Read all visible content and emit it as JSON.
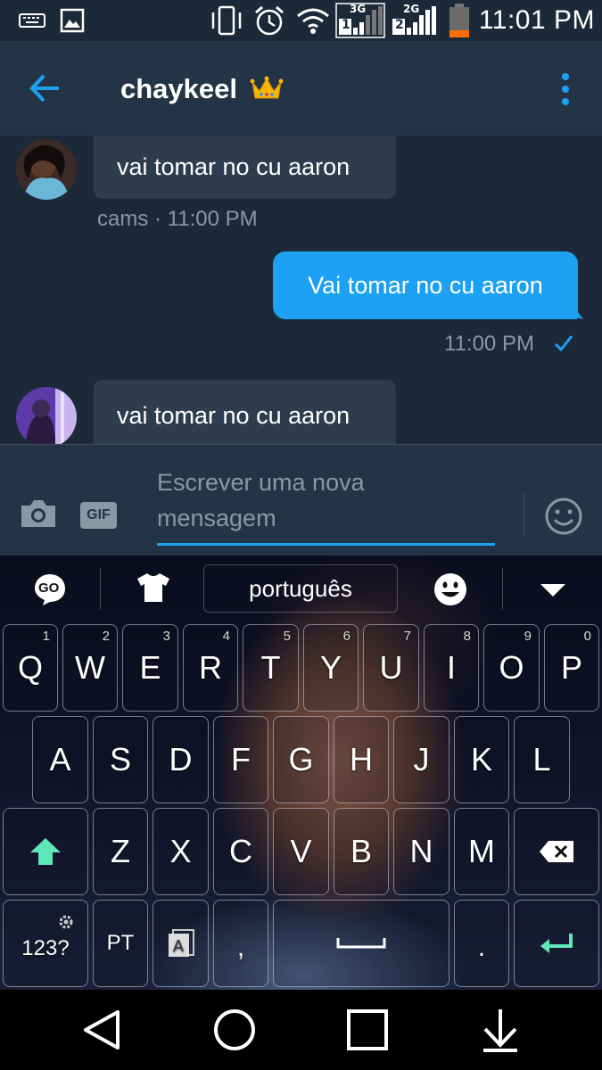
{
  "status_bar": {
    "time": "11:01 PM",
    "sim1_network": "3G",
    "sim1_slot": "1",
    "sim2_network": "2G",
    "sim2_slot": "2",
    "icons": [
      "keyboard-icon",
      "image-icon",
      "vibrate-icon",
      "alarm-icon",
      "wifi-icon",
      "signal-sim1-icon",
      "signal-sim2-icon",
      "battery-icon"
    ],
    "battery_color": "#ff6d00"
  },
  "header": {
    "title": "chaykeel",
    "icons": [
      "back-arrow-icon",
      "crown-emoji",
      "more-vert-icon"
    ]
  },
  "messages": [
    {
      "direction": "incoming",
      "text": "vai tomar no cu aaron",
      "meta": "cams · 11:00 PM"
    },
    {
      "direction": "outgoing",
      "text": "Vai tomar no cu aaron",
      "meta": "11:00 PM",
      "read_icon": "check-icon"
    },
    {
      "direction": "incoming",
      "text": "vai tomar no cu aaron"
    }
  ],
  "composer": {
    "placeholder_line1": "Escrever uma nova",
    "placeholder_line2": "mensagem",
    "icons": [
      "camera-icon",
      "gif-icon",
      "emoji-smiley-icon"
    ],
    "gif_label": "GIF"
  },
  "keyboard": {
    "toolbar": {
      "go_label": "GO",
      "language": "português",
      "icons": [
        "go-logo-icon",
        "theme-shirt-icon",
        "emoji-icon",
        "collapse-triangle-icon"
      ]
    },
    "row1": [
      {
        "k": "Q",
        "h": "1"
      },
      {
        "k": "W",
        "h": "2"
      },
      {
        "k": "E",
        "h": "3"
      },
      {
        "k": "R",
        "h": "4"
      },
      {
        "k": "T",
        "h": "5"
      },
      {
        "k": "Y",
        "h": "6"
      },
      {
        "k": "U",
        "h": "7"
      },
      {
        "k": "I",
        "h": "8"
      },
      {
        "k": "O",
        "h": "9"
      },
      {
        "k": "P",
        "h": "0"
      }
    ],
    "row2": [
      "A",
      "S",
      "D",
      "F",
      "G",
      "H",
      "J",
      "K",
      "L"
    ],
    "row3": [
      "Z",
      "X",
      "C",
      "V",
      "B",
      "N",
      "M"
    ],
    "bottom": {
      "numbers": "123?",
      "lang": "PT",
      "comma": ",",
      "period": "."
    },
    "accent_color": "#5ee8b7"
  },
  "nav_bar": {
    "icons": [
      "back-triangle-icon",
      "home-circle-icon",
      "recents-square-icon",
      "notifications-down-icon"
    ]
  },
  "colors": {
    "background": "#1c2938",
    "header": "#243447",
    "bubble_in": "#2e3d4e",
    "bubble_out": "#1da1f2",
    "meta_text": "#8899a6"
  }
}
